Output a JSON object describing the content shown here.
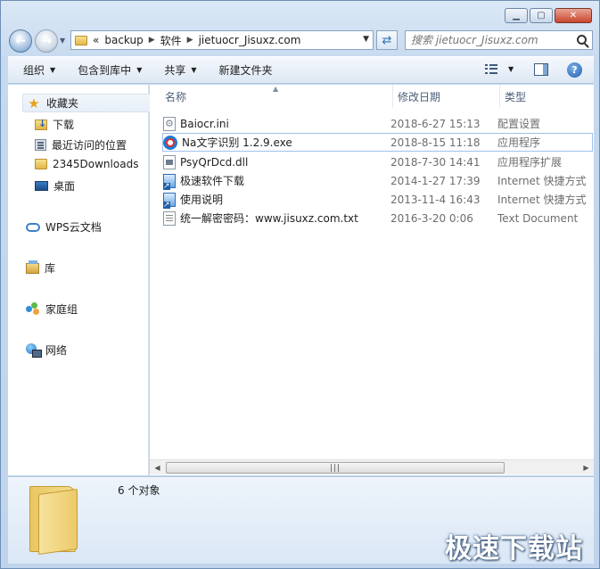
{
  "address_bar": {
    "overflow": "«",
    "crumbs": [
      "backup",
      "软件",
      "jietuocr_Jisuxz.com"
    ]
  },
  "search": {
    "placeholder": "搜索 jietuocr_Jisuxz.com"
  },
  "toolbar": {
    "organize": "组织",
    "include_in_library": "包含到库中",
    "share": "共享",
    "new_folder": "新建文件夹"
  },
  "nav": {
    "favorites": "收藏夹",
    "downloads": "下载",
    "recent": "最近访问的位置",
    "folder_2345": "2345Downloads",
    "desktop": "桌面",
    "wps_cloud": "WPS云文档",
    "libraries": "库",
    "homegroup": "家庭组",
    "network": "网络"
  },
  "columns": {
    "name": "名称",
    "date": "修改日期",
    "type": "类型"
  },
  "files": [
    {
      "name": "Baiocr.ini",
      "date": "2018-6-27 15:13",
      "type": "配置设置",
      "icon": "ini-file-icon"
    },
    {
      "name": "Na文字识别 1.2.9.exe",
      "date": "2018-8-15 11:18",
      "type": "应用程序",
      "icon": "exe-app-icon"
    },
    {
      "name": "PsyQrDcd.dll",
      "date": "2018-7-30 14:41",
      "type": "应用程序扩展",
      "icon": "dll-file-icon"
    },
    {
      "name": "极速软件下载",
      "date": "2014-1-27 17:39",
      "type": "Internet 快捷方式",
      "icon": "internet-shortcut-icon"
    },
    {
      "name": "使用说明",
      "date": "2013-11-4 16:43",
      "type": "Internet 快捷方式",
      "icon": "internet-shortcut-icon"
    },
    {
      "name": "统一解密密码：www.jisuxz.com.txt",
      "date": "2016-3-20 0:06",
      "type": "Text Document",
      "icon": "text-file-icon"
    }
  ],
  "details": {
    "count": "6 个对象"
  },
  "watermark": "极速下载站",
  "colors": {
    "accent": "#3f7fc8",
    "selection_border": "#9fc1e8"
  }
}
